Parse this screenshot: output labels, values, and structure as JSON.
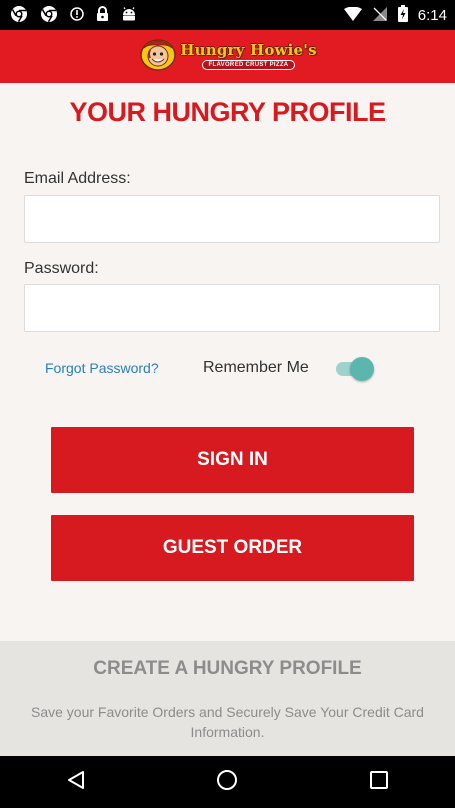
{
  "status_bar": {
    "time": "6:14",
    "icons_left": [
      "chrome-icon",
      "chrome-icon",
      "info-icon",
      "lock-icon",
      "android-icon"
    ],
    "icons_right": [
      "wifi-icon",
      "no-sim-icon",
      "battery-icon"
    ]
  },
  "header": {
    "brand_name": "Hungry Howie's",
    "tagline": "FLAVORED CRUST PIZZA",
    "logo_icon": "mascot-icon",
    "background_color": "#e21b23"
  },
  "page": {
    "title": "YOUR HUNGRY PROFILE",
    "title_color": "#d71920"
  },
  "form": {
    "email_label": "Email Address:",
    "email_value": "",
    "password_label": "Password:",
    "password_value": "",
    "forgot_password": "Forgot Password?",
    "remember_me_label": "Remember Me",
    "remember_me_on": true,
    "toggle_color": "#5bb7ae"
  },
  "buttons": {
    "sign_in": "SIGN IN",
    "guest_order": "GUEST ORDER",
    "button_color": "#d71920"
  },
  "create_profile": {
    "title": "CREATE A HUNGRY PROFILE",
    "description": "Save your Favorite Orders and Securely Save Your Credit Card Information."
  },
  "nav_bar": {
    "icons": [
      "back-icon",
      "home-icon",
      "recents-icon"
    ]
  }
}
